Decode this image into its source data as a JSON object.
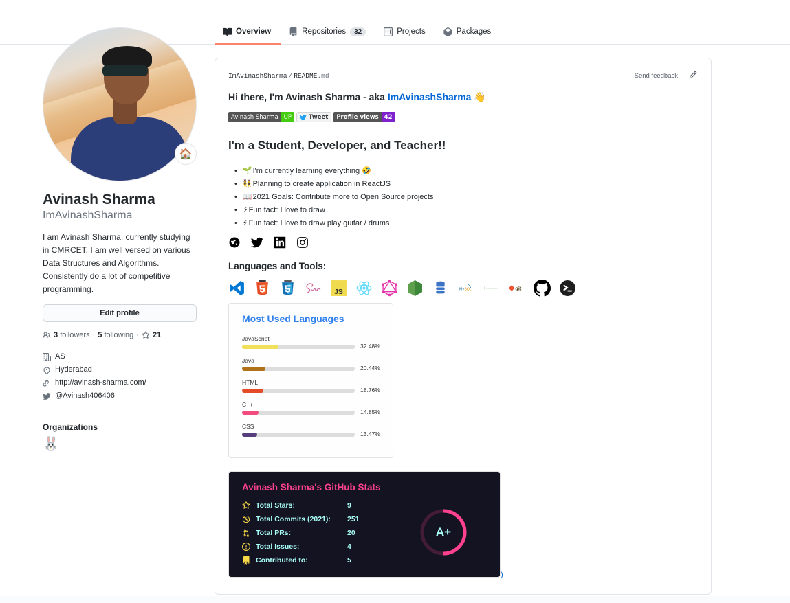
{
  "nav": {
    "tabs": [
      {
        "label": "Overview",
        "icon": "book-icon",
        "active": true
      },
      {
        "label": "Repositories",
        "icon": "repo-icon",
        "count": "32"
      },
      {
        "label": "Projects",
        "icon": "project-icon"
      },
      {
        "label": "Packages",
        "icon": "package-icon"
      }
    ]
  },
  "profile": {
    "status_emoji": "🏠",
    "fullname": "Avinash Sharma",
    "username": "ImAvinashSharma",
    "bio": "I am Avinash Sharma, currently studying in CMRCET. I am well versed on various Data Structures and Algorithms. Consistently do a lot of competitive programming.",
    "edit_label": "Edit profile",
    "followers": "3",
    "followers_label": "followers",
    "following": "5",
    "following_label": "following",
    "stars": "21",
    "company": "AS",
    "location": "Hyderabad",
    "website": "http://avinash-sharma.com/",
    "twitter": "@Avinash406406",
    "organizations_title": "Organizations",
    "org_avatar": "🐰"
  },
  "readme": {
    "owner": "ImAvinashSharma",
    "file": "README",
    "ext": ".md",
    "feedback": "Send feedback",
    "greeting": "Hi there, I'm Avinash Sharma - aka ",
    "greeting_link": "ImAvinashSharma",
    "greeting_emoji": "👋",
    "badges": {
      "name_left": "Avinash Sharma",
      "name_right": "UP",
      "tweet": "Tweet",
      "views_left": "Profile views",
      "views_right": "42"
    },
    "heading": "I'm a Student, Developer, and Teacher!!",
    "bullets": [
      {
        "emoji": "🌱",
        "text": "I'm currently learning everything 🤣"
      },
      {
        "emoji": "👯",
        "text": "Planning to create application in ReactJS"
      },
      {
        "emoji": "📖",
        "text": "2021 Goals: Contribute more to Open Source projects"
      },
      {
        "emoji": "⚡",
        "text": "Fun fact: I love to draw"
      },
      {
        "emoji": "⚡",
        "text": "Fun fact: I love to draw play guitar / drums"
      }
    ],
    "socials": [
      "website-icon",
      "twitter-icon",
      "linkedin-icon",
      "instagram-icon"
    ],
    "tools_heading": "Languages and Tools:",
    "tools": [
      "vscode",
      "html5",
      "css3",
      "sass",
      "javascript",
      "react",
      "graphql",
      "nodejs",
      "database",
      "mysql",
      "mongodb",
      "git",
      "github",
      "terminal"
    ],
    "trailing_text": ")"
  },
  "top_langs": {
    "title": "Most Used Languages",
    "languages": [
      {
        "name": "JavaScript",
        "percent": 32.48,
        "label": "32.48%",
        "color": "#f1e05a"
      },
      {
        "name": "Java",
        "percent": 20.44,
        "label": "20.44%",
        "color": "#b07219"
      },
      {
        "name": "HTML",
        "percent": 18.76,
        "label": "18.76%",
        "color": "#e34c26"
      },
      {
        "name": "C++",
        "percent": 14.85,
        "label": "14.85%",
        "color": "#f34b7d"
      },
      {
        "name": "CSS",
        "percent": 13.47,
        "label": "13.47%",
        "color": "#563d7c"
      }
    ]
  },
  "stats": {
    "title": "Avinash Sharma's GitHub Stats",
    "rows": [
      {
        "icon": "star-icon",
        "label": "Total Stars:",
        "value": "9"
      },
      {
        "icon": "history-icon",
        "label": "Total Commits (2021):",
        "value": "251"
      },
      {
        "icon": "pull-request-icon",
        "label": "Total PRs:",
        "value": "20"
      },
      {
        "icon": "issue-icon",
        "label": "Total Issues:",
        "value": "4"
      },
      {
        "icon": "repo-icon",
        "label": "Contributed to:",
        "value": "5"
      }
    ],
    "rank": "A+",
    "rank_progress": 0.5,
    "colors": {
      "title": "#fe428e",
      "text": "#a9fef7",
      "icon": "#f8d847",
      "ring": "#fe428e",
      "bg": "#141321"
    }
  }
}
